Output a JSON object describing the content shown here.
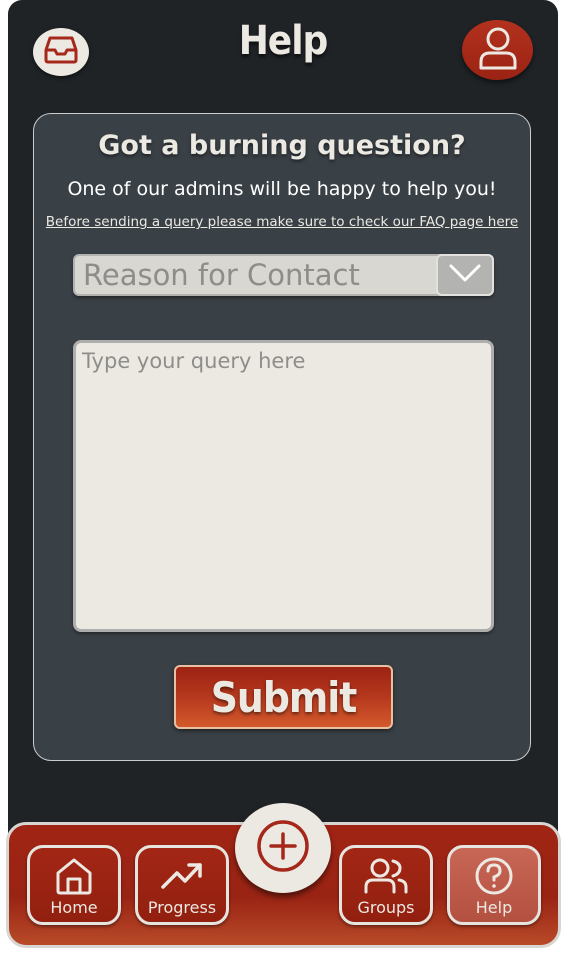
{
  "header": {
    "title": "Help",
    "inbox_icon": "inbox-icon",
    "profile_icon": "user-icon"
  },
  "card": {
    "heading": "Got a burning question?",
    "subheading": "One of our admins will be happy to help you!",
    "faq_link": "Before sending a query please make sure to check our FAQ page here",
    "reason_select": {
      "placeholder": "Reason for Contact",
      "icon": "chevron-down-icon"
    },
    "query": {
      "placeholder": "Type your query here"
    },
    "submit_label": "Submit"
  },
  "nav": {
    "items": [
      {
        "label": "Home",
        "icon": "home-icon",
        "active": false
      },
      {
        "label": "Progress",
        "icon": "trending-up-icon",
        "active": false
      },
      {
        "label": "Groups",
        "icon": "users-icon",
        "active": false
      },
      {
        "label": "Help",
        "icon": "help-circle-icon",
        "active": true
      }
    ],
    "add_icon": "plus-circle-icon"
  },
  "colors": {
    "background": "#1f2326",
    "card": "#3a4146",
    "accent": "#9b2313",
    "cream": "#ece9e3"
  }
}
